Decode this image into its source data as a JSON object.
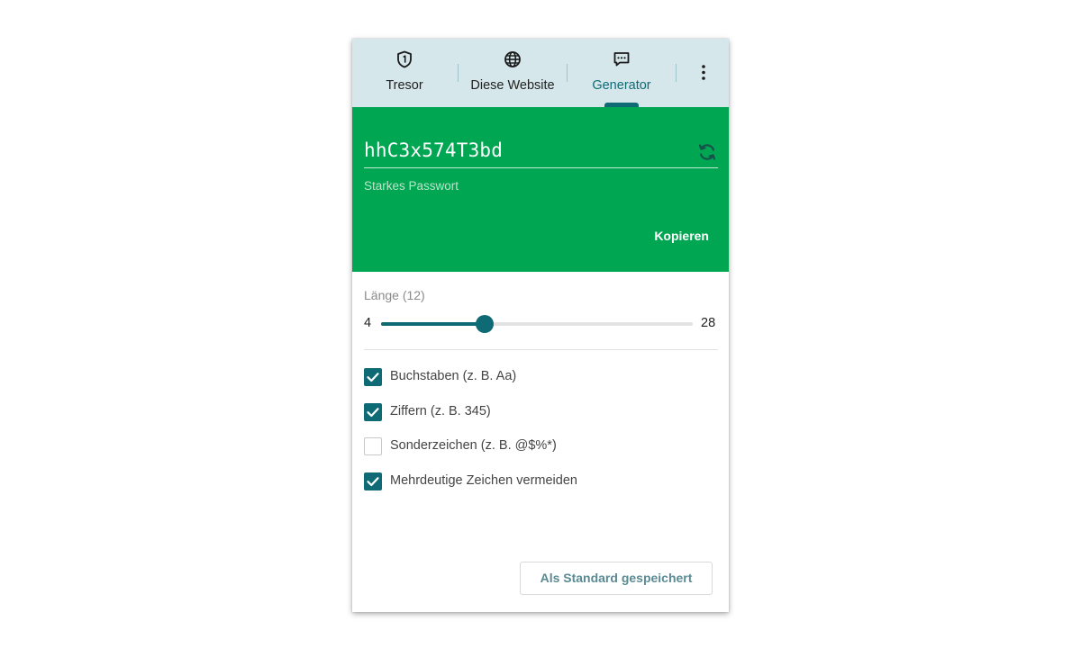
{
  "tabs": [
    {
      "label": "Tresor",
      "icon": "shield-icon"
    },
    {
      "label": "Diese Website",
      "icon": "globe-icon"
    },
    {
      "label": "Generator",
      "icon": "chat-icon",
      "active": true
    }
  ],
  "menu": {
    "icon": "more-vertical-icon"
  },
  "generator": {
    "password": "hhC3x574T3bd",
    "strength": "Starkes Passwort",
    "copy_label": "Kopieren",
    "refresh_icon": "refresh-icon"
  },
  "length": {
    "label": "Länge (12)",
    "min": 4,
    "max": 28,
    "value": 12
  },
  "options": [
    {
      "label": "Buchstaben (z. B. Aa)",
      "checked": true
    },
    {
      "label": "Ziffern (z. B. 345)",
      "checked": true
    },
    {
      "label": "Sonderzeichen (z. B. @$%*)",
      "checked": false
    },
    {
      "label": "Mehrdeutige Zeichen vermeiden",
      "checked": true
    }
  ],
  "footer": {
    "save_default_label": "Als Standard gespeichert"
  },
  "colors": {
    "header_bg": "#d6e7ec",
    "password_bg": "#00a651",
    "accent": "#0e6b75",
    "strength_text": "#b8e6c9"
  }
}
